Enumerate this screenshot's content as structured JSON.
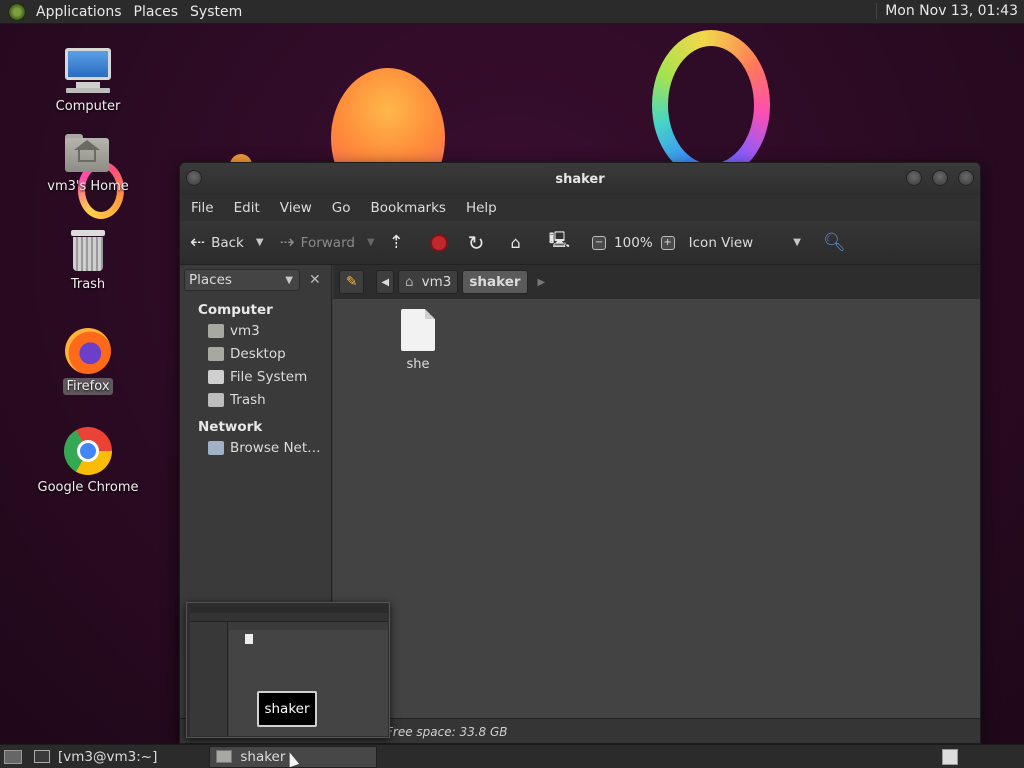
{
  "top_panel": {
    "menus": [
      "Applications",
      "Places",
      "System"
    ],
    "clock": "Mon Nov 13, 01:43"
  },
  "desktop_icons": [
    {
      "label": "Computer",
      "icon": "computer-icon"
    },
    {
      "label": "vm3's Home",
      "icon": "home-folder-icon"
    },
    {
      "label": "Trash",
      "icon": "trash-icon"
    },
    {
      "label": "Firefox",
      "icon": "firefox-icon",
      "selected": true
    },
    {
      "label": "Google Chrome",
      "icon": "chrome-icon"
    }
  ],
  "window": {
    "title": "shaker",
    "menu": [
      "File",
      "Edit",
      "View",
      "Go",
      "Bookmarks",
      "Help"
    ],
    "toolbar": {
      "back": "Back",
      "forward": "Forward",
      "zoom": "100%",
      "view_mode": "Icon View"
    },
    "sidebar": {
      "selector": "Places",
      "sections": [
        {
          "title": "Computer",
          "items": [
            "vm3",
            "Desktop",
            "File System",
            "Trash"
          ]
        },
        {
          "title": "Network",
          "items": [
            "Browse Net…"
          ]
        }
      ]
    },
    "path": [
      "vm3",
      "shaker"
    ],
    "files": [
      {
        "name": "she",
        "icon": "document-icon"
      }
    ],
    "status": "Free space: 33.8 GB"
  },
  "preview": {
    "label": "shaker"
  },
  "taskbar": {
    "tasks": [
      {
        "label": "[vm3@vm3:~]",
        "icon": "terminal-icon"
      },
      {
        "label": "shaker",
        "icon": "folder-icon",
        "active": true
      }
    ]
  }
}
